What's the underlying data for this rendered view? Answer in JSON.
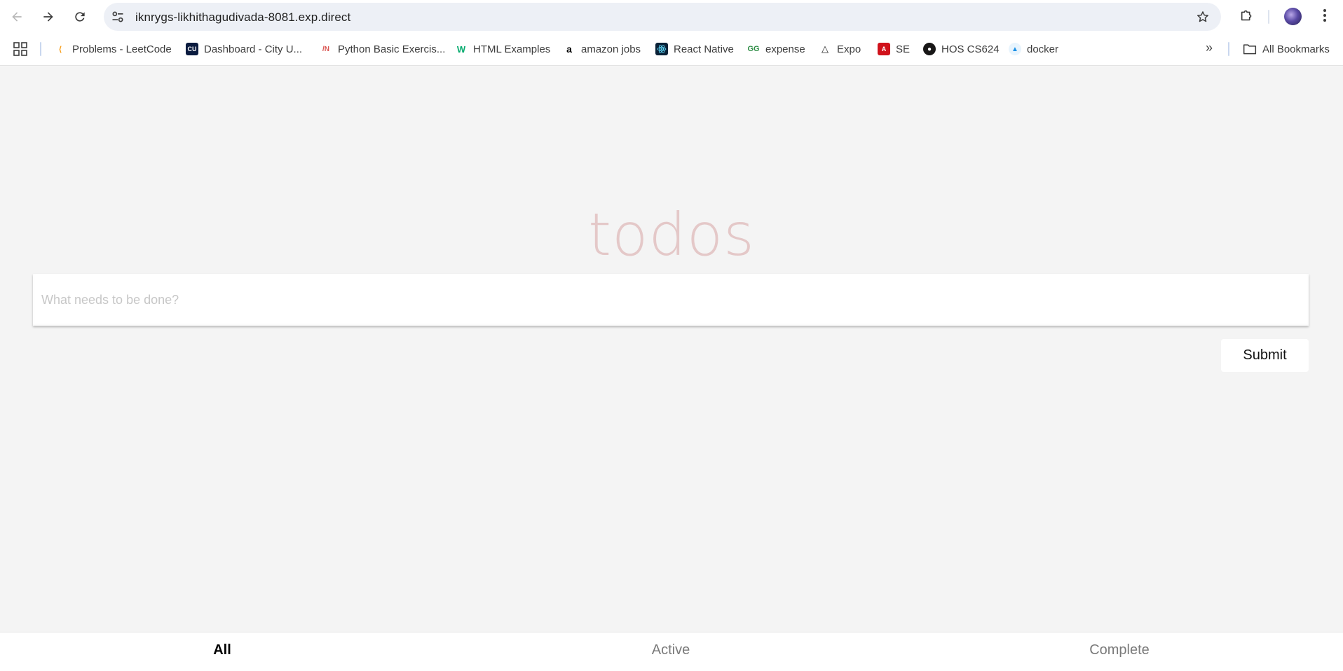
{
  "browser": {
    "url": "iknrygs-likhithagudivada-8081.exp.direct",
    "bookmarks": [
      {
        "label": "Problems - LeetCode",
        "icon": "leetcode-icon",
        "icon_color": "#f89f1b"
      },
      {
        "label": "Dashboard - City U...",
        "icon": "cityu-icon",
        "icon_color": "#0b1b3f"
      },
      {
        "label": "Python Basic Exercis...",
        "icon": "w3resource-icon",
        "icon_color": "#d9534f"
      },
      {
        "label": "HTML Examples",
        "icon": "w3schools-icon",
        "icon_color": "#04aa6d"
      },
      {
        "label": "amazon jobs",
        "icon": "amazon-icon",
        "icon_color": "#000000"
      },
      {
        "label": "React Native",
        "icon": "react-icon",
        "icon_color": "#0a2238"
      },
      {
        "label": "expense",
        "icon": "geeksforgeeks-icon",
        "icon_color": "#2f8d46"
      },
      {
        "label": "Expo",
        "icon": "expo-icon",
        "icon_color": "#222222"
      },
      {
        "label": "SE",
        "icon": "pdf-icon",
        "icon_color": "#d0121b"
      },
      {
        "label": "HOS CS624",
        "icon": "github-icon",
        "icon_color": "#181717"
      },
      {
        "label": "docker",
        "icon": "docker-icon",
        "icon_color": "#1d91e6"
      }
    ],
    "all_bookmarks_label": "All Bookmarks"
  },
  "app": {
    "title": "todos",
    "input_placeholder": "What needs to be done?",
    "submit_label": "Submit",
    "filters": [
      {
        "label": "All",
        "selected": true
      },
      {
        "label": "Active",
        "selected": false
      },
      {
        "label": "Complete",
        "selected": false
      }
    ]
  },
  "colors": {
    "page_background": "#f4f4f4",
    "title_color": "rgba(175, 47, 47, 0.22)",
    "selected_filter": "#000000",
    "unselected_filter": "#7a7a7a"
  }
}
